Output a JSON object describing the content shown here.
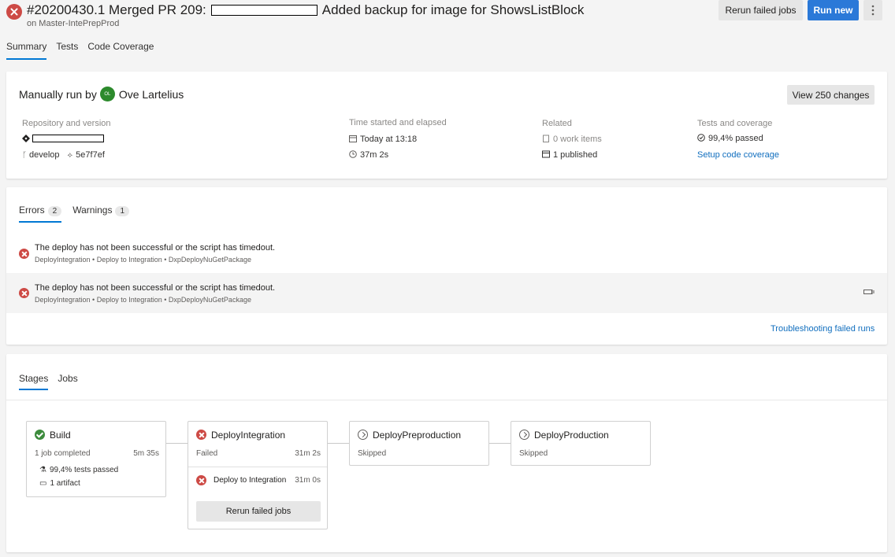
{
  "header": {
    "title_prefix": "#20200430.1 Merged PR 209:",
    "title_suffix": "Added backup for image for ShowsListBlock",
    "subtitle": "on Master-IntePrepProd",
    "rerun_label": "Rerun failed jobs",
    "run_new_label": "Run new",
    "more_icon": "more-vertical-icon"
  },
  "tabs": [
    "Summary",
    "Tests",
    "Code Coverage"
  ],
  "summary": {
    "run_by_label": "Manually run by",
    "avatar_initials": "OL",
    "user": "Ove Lartelius",
    "view_changes_label": "View 250 changes",
    "repo_label": "Repository and version",
    "branch": "develop",
    "commit": "5e7f7ef",
    "time_label": "Time started and elapsed",
    "started": "Today at 13:18",
    "elapsed": "37m 2s",
    "related_label": "Related",
    "work_items": "0 work items",
    "published": "1 published",
    "tests_label": "Tests and coverage",
    "tests_passed": "99,4% passed",
    "setup_coverage": "Setup code coverage"
  },
  "issues": {
    "errors_label": "Errors",
    "errors_count": "2",
    "warnings_label": "Warnings",
    "warnings_count": "1",
    "items": [
      {
        "message": "The deploy has not been successful or the script has timedout.",
        "path": "DeployIntegration • Deploy to Integration • DxpDeployNuGetPackage"
      },
      {
        "message": "The deploy has not been successful or the script has timedout.",
        "path": "DeployIntegration • Deploy to Integration • DxpDeployNuGetPackage"
      }
    ],
    "troubleshoot_link": "Troubleshooting failed runs"
  },
  "stages_panel": {
    "tab_stages": "Stages",
    "tab_jobs": "Jobs",
    "stages": [
      {
        "name": "Build",
        "status": "1 job completed",
        "duration": "5m 35s",
        "tests": "99,4% tests passed",
        "artifact": "1 artifact"
      },
      {
        "name": "DeployIntegration",
        "status": "Failed",
        "duration": "31m 2s",
        "job_name": "Deploy to Integration",
        "job_duration": "31m 0s",
        "rerun_label": "Rerun failed jobs"
      },
      {
        "name": "DeployPreproduction",
        "status": "Skipped"
      },
      {
        "name": "DeployProduction",
        "status": "Skipped"
      }
    ]
  },
  "colors": {
    "error": "#cd4a45",
    "success": "#3c8b3c",
    "primary": "#2b79d8",
    "link": "#106ebe"
  }
}
